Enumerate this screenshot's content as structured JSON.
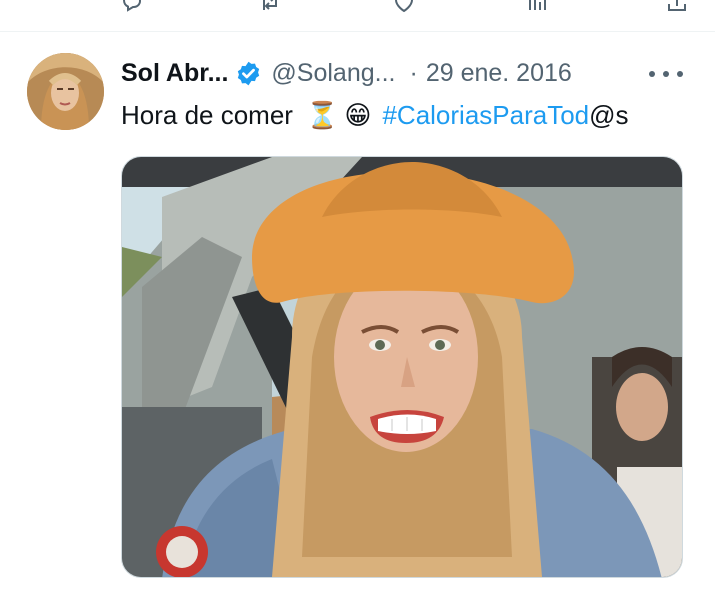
{
  "previous_tweet_actions": {
    "icons": [
      "reply-icon",
      "retweet-icon",
      "like-icon",
      "views-icon",
      "bookmark-icon",
      "share-icon"
    ]
  },
  "tweet": {
    "author_name": "Sol Abr...",
    "verified": true,
    "handle": "@Solang...",
    "separator": "·",
    "date": "29 ene. 2016",
    "text": "Hora de comer",
    "emojis": [
      "⏳",
      "😁"
    ],
    "hashtag": "#CaloriasParaTod",
    "text_suffix": "@s"
  },
  "colors": {
    "accent": "#1d9bf0",
    "secondary_text": "#536471",
    "primary_text": "#0f1419"
  }
}
